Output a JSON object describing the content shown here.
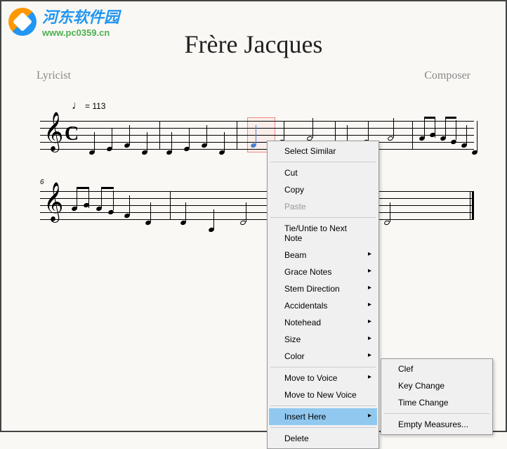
{
  "watermark": {
    "title": "河东软件园",
    "url": "www.pc0359.cn"
  },
  "score": {
    "title": "Frère Jacques",
    "lyricist": "Lyricist",
    "composer": "Composer",
    "tempo_value": "= 113",
    "time_signature": "C",
    "measure_6": "6"
  },
  "menu1": {
    "select_similar": "Select Similar",
    "cut": "Cut",
    "copy": "Copy",
    "paste": "Paste",
    "tie_untie": "Tie/Untie to Next Note",
    "beam": "Beam",
    "grace_notes": "Grace Notes",
    "stem_direction": "Stem Direction",
    "accidentals": "Accidentals",
    "notehead": "Notehead",
    "size": "Size",
    "color": "Color",
    "move_to_voice": "Move to Voice",
    "move_to_new_voice": "Move to New Voice",
    "insert_here": "Insert Here",
    "delete": "Delete"
  },
  "menu2": {
    "clef": "Clef",
    "key_change": "Key Change",
    "time_change": "Time Change",
    "empty_measures": "Empty Measures..."
  }
}
